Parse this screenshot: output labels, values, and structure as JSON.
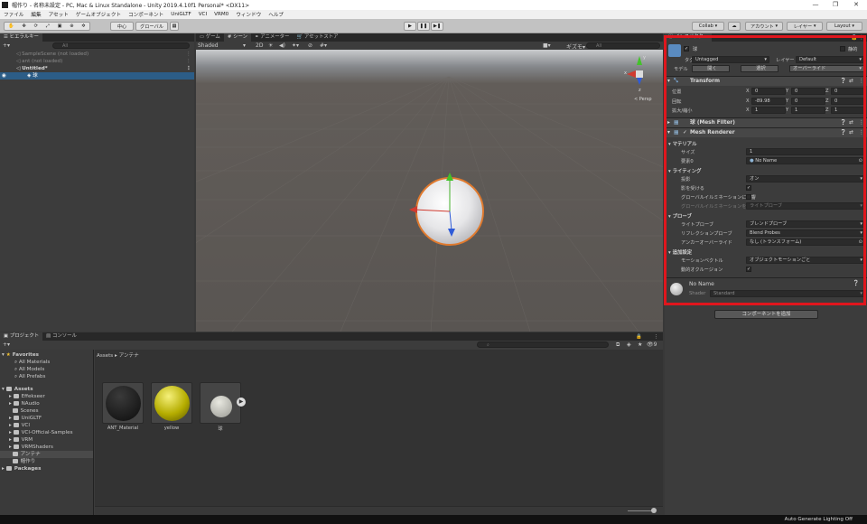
{
  "window": {
    "title": "帽作り - 名称未設定 - PC, Mac & Linux Standalone - Unity 2019.4.10f1 Personal* <DX11>",
    "minimize": "—",
    "maximize": "❐",
    "close": "✕"
  },
  "menu": [
    "ファイル",
    "編集",
    "アセット",
    "ゲームオブジェクト",
    "コンポーネント",
    "UniGLTF",
    "VCI",
    "VRM0",
    "ウィンドウ",
    "ヘルプ"
  ],
  "toolbar": {
    "pivot": "中心",
    "space": "グローバル",
    "collab": "Collab ▾",
    "account": "アカウント",
    "layers": "レイヤー",
    "layout": "Layout"
  },
  "hierarchy": {
    "tab": "ヒエラルキー",
    "add": "+▾",
    "search_placeholder": "All",
    "items": [
      {
        "label": "SampleScene (not loaded)"
      },
      {
        "label": "ant (not loaded)"
      },
      {
        "label": "Untitled*"
      },
      {
        "label": "球"
      }
    ]
  },
  "scene": {
    "tabs": [
      "ゲーム",
      "シーン",
      "アニメーター",
      "アセットストア"
    ],
    "shading": "Shaded",
    "mode2d": "2D",
    "gizmos": "ギズモ",
    "search_placeholder": "All",
    "persp": "< Persp"
  },
  "inspector": {
    "tab": "インスペクター",
    "object_name": "球",
    "static": "静的",
    "tag_label": "タグ",
    "tag_value": "Untagged",
    "layer_label": "レイヤー",
    "layer_value": "Default",
    "model_label": "モデル",
    "open": "開く",
    "select": "選択",
    "overrides": "オーバーライド",
    "transform": {
      "title": "Transform",
      "position_label": "位置",
      "rotation_label": "回転",
      "scale_label": "拡大/縮小",
      "position": {
        "x": "0",
        "y": "0",
        "z": "0"
      },
      "rotation": {
        "x": "-89.98",
        "y": "0",
        "z": "0"
      },
      "scale": {
        "x": "1",
        "y": "1",
        "z": "1"
      }
    },
    "mesh_filter": "球 (Mesh Filter)",
    "mesh_renderer": "Mesh Renderer",
    "materials_section": "マテリアル",
    "size_label": "サイズ",
    "size_value": "1",
    "element0_label": "要素0",
    "element0_value": "No Name",
    "lighting_section": "ライティング",
    "cast_shadows_label": "投影",
    "cast_shadows_value": "オン",
    "receive_shadows_label": "影を受ける",
    "gi_contribute_label": "グローバルイルミネーションに影響",
    "gi_receive_label": "グローバルイルミネーションを受け",
    "gi_receive_value": "ライトプローブ",
    "probes_section": "プローブ",
    "light_probes_label": "ライトプローブ",
    "light_probes_value": "ブレンドプローブ",
    "reflection_label": "リフレクションプローブ",
    "reflection_value": "Blend Probes",
    "anchor_label": "アンカーオーバーライド",
    "anchor_value": "なし (トランスフォーム)",
    "additional_section": "追加設定",
    "motion_label": "モーションベクトル",
    "motion_value": "オブジェクトモーションごと",
    "dynamic_occ_label": "動的オクルージョン",
    "material_name": "No Name",
    "shader_label": "Shader",
    "shader_value": "Standard",
    "add_component": "コンポーネントを追加"
  },
  "project": {
    "tabs": [
      "プロジェクト",
      "コンソール"
    ],
    "add": "+▾",
    "count": "9",
    "favorites_title": "Favorites",
    "favorites": [
      "All Materials",
      "All Models",
      "All Prefabs"
    ],
    "assets_title": "Assets",
    "folders": [
      "Effekseer",
      "NAudio",
      "Scenes",
      "UniGLTF",
      "VCI",
      "VCI-Official-Samples",
      "VRM",
      "VRMShaders",
      "アンテナ",
      "帽作り"
    ],
    "packages": "Packages",
    "breadcrumb": [
      "Assets",
      "アンテナ"
    ],
    "items": [
      {
        "label": "ANT_Material",
        "color": "#111111"
      },
      {
        "label": "yellow",
        "color": "#c8c000"
      },
      {
        "label": "球",
        "color": "#b8b8b0"
      }
    ]
  },
  "status": {
    "right": "Auto Generate Lighting Off"
  },
  "colors": {
    "highlight": "#e0161d",
    "selection": "#2c5d87"
  }
}
